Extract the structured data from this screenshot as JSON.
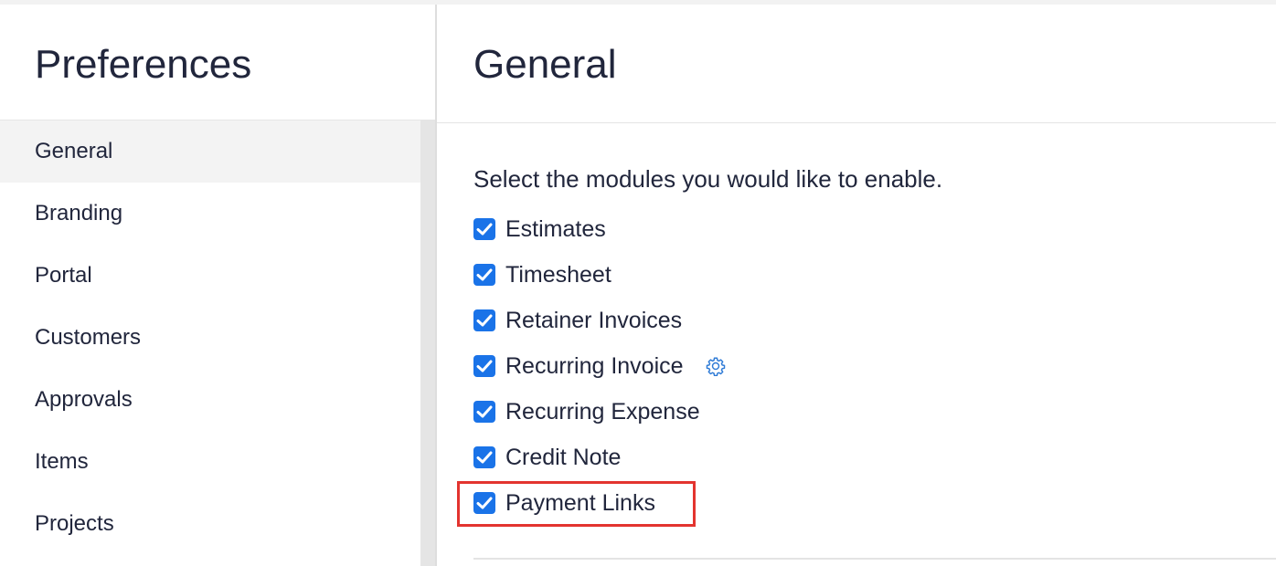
{
  "sidebar": {
    "title": "Preferences",
    "items": [
      {
        "label": "General",
        "active": true
      },
      {
        "label": "Branding",
        "active": false
      },
      {
        "label": "Portal",
        "active": false
      },
      {
        "label": "Customers",
        "active": false
      },
      {
        "label": "Approvals",
        "active": false
      },
      {
        "label": "Items",
        "active": false
      },
      {
        "label": "Projects",
        "active": false
      }
    ]
  },
  "main": {
    "title": "General",
    "prompt": "Select the modules you would like to enable.",
    "modules": [
      {
        "label": "Estimates",
        "checked": true
      },
      {
        "label": "Timesheet",
        "checked": true
      },
      {
        "label": "Retainer Invoices",
        "checked": true
      },
      {
        "label": "Recurring Invoice",
        "checked": true,
        "icon": "gear-icon"
      },
      {
        "label": "Recurring Expense",
        "checked": true
      },
      {
        "label": "Credit Note",
        "checked": true
      },
      {
        "label": "Payment Links",
        "checked": true,
        "highlighted": true
      }
    ]
  },
  "colors": {
    "checkbox": "#1a73e8",
    "highlight_border": "#e3342f",
    "gear": "#2f7bd6"
  }
}
